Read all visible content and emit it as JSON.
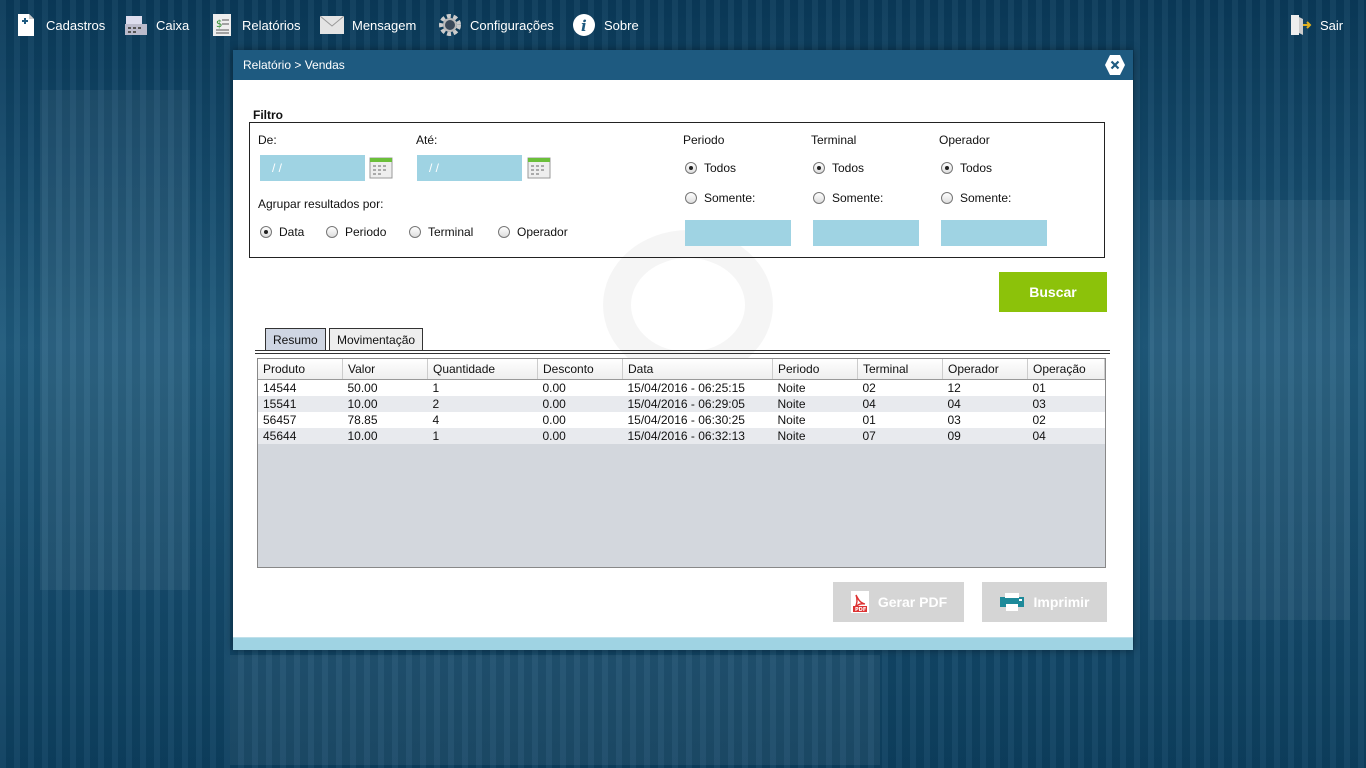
{
  "menu": {
    "cadastros": "Cadastros",
    "caixa": "Caixa",
    "relatorios": "Relatórios",
    "mensagem": "Mensagem",
    "configuracoes": "Configurações",
    "sobre": "Sobre",
    "sair": "Sair"
  },
  "modal": {
    "breadcrumb": "Relatório > Vendas",
    "filtro_label": "Filtro",
    "de_label": "De:",
    "ate_label": "Até:",
    "de_value": "/ /",
    "ate_value": "/ /",
    "agrupar_label": "Agrupar resultados por:",
    "agrupar_options": [
      "Data",
      "Periodo",
      "Terminal",
      "Operador"
    ],
    "agrupar_selected": "Data",
    "periodo_title": "Periodo",
    "terminal_title": "Terminal",
    "operador_title": "Operador",
    "todos_label": "Todos",
    "somente_label": "Somente:",
    "buscar_label": "Buscar",
    "tabs": [
      "Resumo",
      "Movimentação"
    ],
    "active_tab": "Resumo",
    "gerar_pdf_label": "Gerar PDF",
    "imprimir_label": "Imprimir"
  },
  "table": {
    "columns": [
      "Produto",
      "Valor",
      "Quantidade",
      "Desconto",
      "Data",
      "Periodo",
      "Terminal",
      "Operador",
      "Operação"
    ],
    "rows": [
      [
        "14544",
        "50.00",
        "1",
        "0.00",
        "15/04/2016 - 06:25:15",
        "Noite",
        "02",
        "12",
        "01"
      ],
      [
        "15541",
        "10.00",
        "2",
        "0.00",
        "15/04/2016 - 06:29:05",
        "Noite",
        "04",
        "04",
        "03"
      ],
      [
        "56457",
        "78.85",
        "4",
        "0.00",
        "15/04/2016 - 06:30:25",
        "Noite",
        "01",
        "03",
        "02"
      ],
      [
        "45644",
        "10.00",
        "1",
        "0.00",
        "15/04/2016 - 06:32:13",
        "Noite",
        "07",
        "09",
        "04"
      ]
    ]
  },
  "colors": {
    "header": "#1e5a80",
    "input": "#9fd3e3",
    "buscar": "#8cc20a",
    "disabled_button": "#d5d5d5"
  },
  "icons": [
    "document-plus-icon",
    "cash-register-icon",
    "report-icon",
    "envelope-icon",
    "gear-icon",
    "info-icon",
    "exit-door-icon",
    "close-icon",
    "calendar-icon",
    "pdf-icon",
    "printer-icon"
  ]
}
